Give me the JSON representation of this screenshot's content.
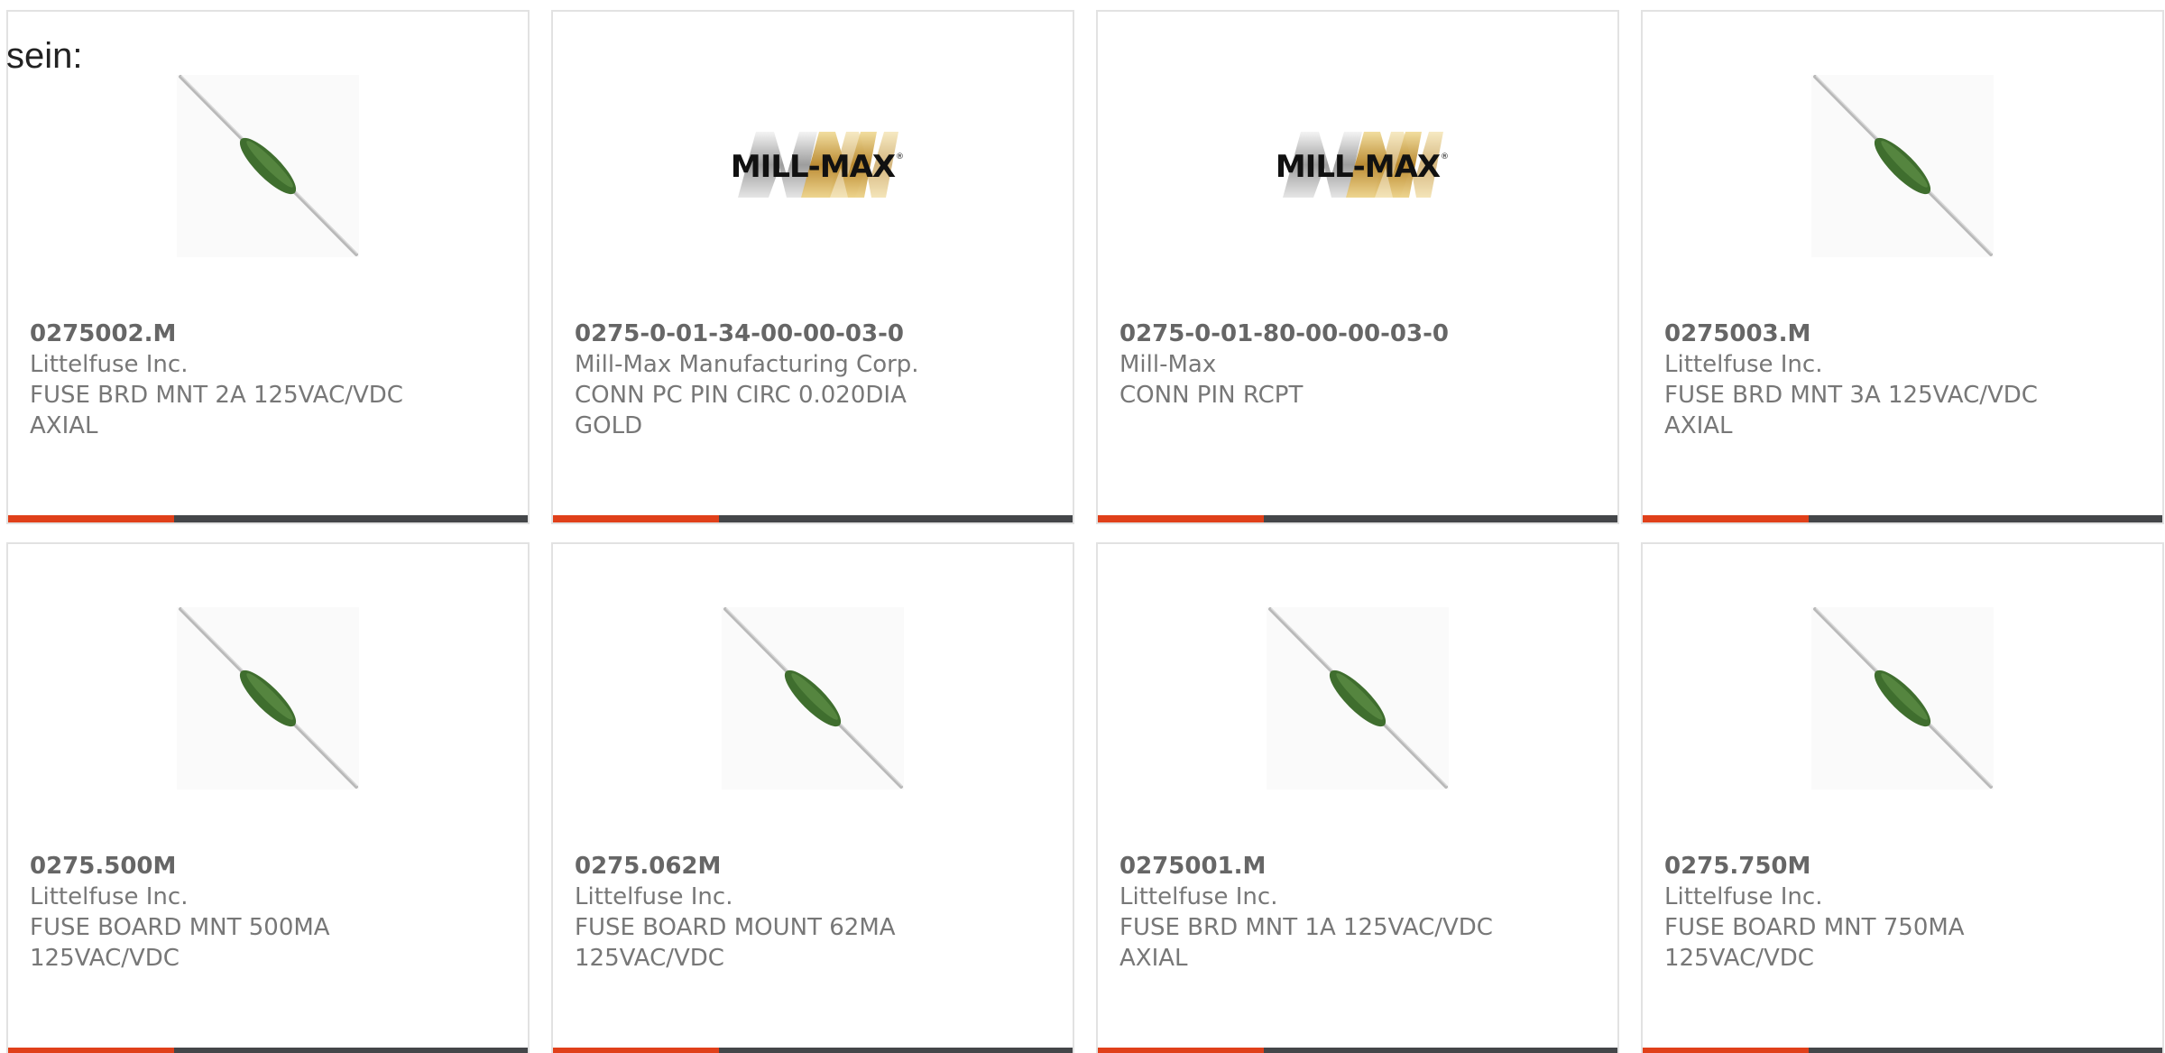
{
  "lead_text": "sein:",
  "colors": {
    "accent": "#e0401a",
    "bar_track": "#444649",
    "card_border": "#e2e2e2",
    "fuse_body": "#3f6e2e"
  },
  "products": [
    {
      "part_number": "0275002.M",
      "manufacturer": "Littelfuse Inc.",
      "description": "FUSE BRD MNT 2A 125VAC/VDC AXIAL",
      "image": "axial-fuse-icon",
      "progress": 0.32
    },
    {
      "part_number": "0275-0-01-34-00-00-03-0",
      "manufacturer": "Mill-Max Manufacturing Corp.",
      "description": "CONN PC PIN CIRC 0.020DIA GOLD",
      "image": "mill-max-logo",
      "progress": 0.32
    },
    {
      "part_number": "0275-0-01-80-00-00-03-0",
      "manufacturer": "Mill-Max",
      "description": "CONN PIN RCPT",
      "image": "mill-max-logo",
      "progress": 0.32
    },
    {
      "part_number": "0275003.M",
      "manufacturer": "Littelfuse Inc.",
      "description": "FUSE BRD MNT 3A 125VAC/VDC AXIAL",
      "image": "axial-fuse-icon",
      "progress": 0.32
    },
    {
      "part_number": "0275.500M",
      "manufacturer": "Littelfuse Inc.",
      "description": "FUSE BOARD MNT 500MA 125VAC/VDC",
      "image": "axial-fuse-icon",
      "progress": 0.32
    },
    {
      "part_number": "0275.062M",
      "manufacturer": "Littelfuse Inc.",
      "description": "FUSE BOARD MOUNT 62MA 125VAC/VDC",
      "image": "axial-fuse-icon",
      "progress": 0.32
    },
    {
      "part_number": "0275001.M",
      "manufacturer": "Littelfuse Inc.",
      "description": "FUSE BRD MNT 1A 125VAC/VDC AXIAL",
      "image": "axial-fuse-icon",
      "progress": 0.32
    },
    {
      "part_number": "0275.750M",
      "manufacturer": "Littelfuse Inc.",
      "description": "FUSE BOARD MNT 750MA 125VAC/VDC",
      "image": "axial-fuse-icon",
      "progress": 0.32
    }
  ],
  "logo_text": "MILL-MAX"
}
